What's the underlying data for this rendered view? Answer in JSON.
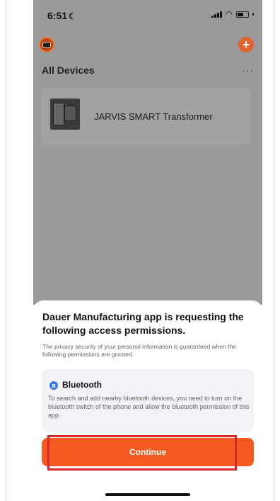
{
  "status_bar": {
    "time": "6:51",
    "moon_icon": "☾"
  },
  "header": {
    "add_symbol": "+"
  },
  "devices": {
    "title": "All Devices",
    "more_symbol": "···",
    "items": [
      {
        "name": "JARVIS SMART Transformer"
      }
    ]
  },
  "permission_sheet": {
    "title": "Dauer Manufacturing app is requesting the following access permissions.",
    "subtitle": "The privacy security of your personal information is guaranteed when the following permissions are granted.",
    "permission": {
      "icon_glyph": "ʙ",
      "title": "Bluetooth",
      "description": "To search and add nearby bluetooth devices, you need to turn on the bluetooth switch of the phone and allow the bluetooth permission of this app."
    },
    "continue_label": "Continue"
  },
  "colors": {
    "accent": "#f55a23",
    "highlight": "#d62828",
    "bluetooth": "#3578e5"
  }
}
